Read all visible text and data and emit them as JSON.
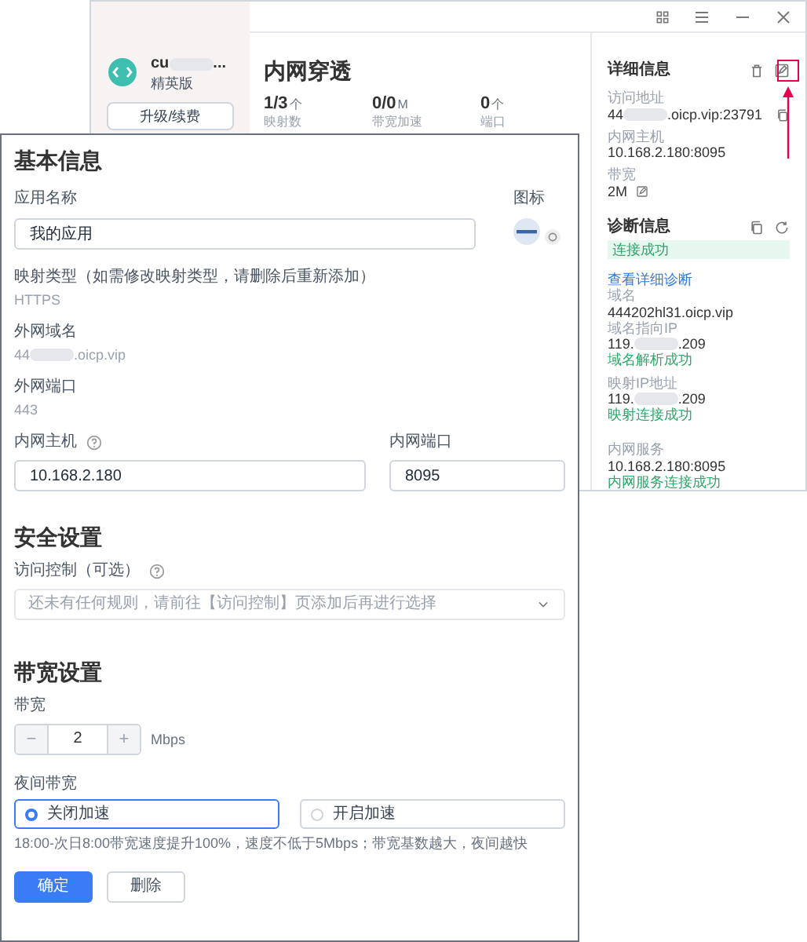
{
  "sidebar": {
    "app_name": {
      "before": "cu",
      "after": "..."
    },
    "edition": "精英版",
    "upgrade_button": "升级/续费"
  },
  "overview": {
    "title": "内网穿透",
    "stats": [
      {
        "value": "1/3",
        "unit": "个",
        "label": "映射数"
      },
      {
        "value": "0/0",
        "unit": "M",
        "label": "带宽加速"
      },
      {
        "value": "0",
        "unit": "个",
        "label": "端口"
      }
    ]
  },
  "details": {
    "title": "详细信息",
    "fields": [
      {
        "label": "访问地址",
        "value": {
          "before": "44",
          "after": ".oicp.vip:23791"
        },
        "kind": "copy"
      },
      {
        "label": "内网主机",
        "value": "10.168.2.180:8095",
        "kind": "plain"
      },
      {
        "label": "带宽",
        "value": "2M",
        "kind": "edit"
      }
    ]
  },
  "diagnosis": {
    "title": "诊断信息",
    "status": "连接成功",
    "link": "查看详细诊断",
    "items": [
      {
        "label": "域名",
        "value": "444202hl31.oicp.vip"
      },
      {
        "label": "域名指向IP",
        "value": {
          "before": "119.",
          "after": ".209"
        },
        "result": "域名解析成功"
      },
      {
        "label": "映射IP地址",
        "value": {
          "before": "119.",
          "after": ".209"
        },
        "result": "映射连接成功"
      },
      {
        "label": "内网服务",
        "value": "10.168.2.180:8095",
        "result": "内网服务连接成功"
      }
    ]
  },
  "dialog": {
    "basic": {
      "title": "基本信息",
      "app_name": {
        "label": "应用名称",
        "value": "我的应用"
      },
      "icon_label": "图标",
      "mapping_type": {
        "label": "映射类型（如需修改映射类型，请删除后重新添加）",
        "value": "HTTPS"
      },
      "domain": {
        "label": "外网域名",
        "value": {
          "before": "44",
          "after": ".oicp.vip"
        }
      },
      "port": {
        "label": "外网端口",
        "value": "443"
      },
      "host": {
        "label": "内网主机",
        "value": "10.168.2.180"
      },
      "inner_port": {
        "label": "内网端口",
        "value": "8095"
      }
    },
    "security": {
      "title": "安全设置",
      "access_control": {
        "label": "访问控制（可选）",
        "placeholder": "还未有任何规则，请前往【访问控制】页添加后再进行选择"
      }
    },
    "bandwidth": {
      "title": "带宽设置",
      "label": "带宽",
      "decrement": "−",
      "value": "2",
      "increment": "+",
      "unit": "Mbps",
      "night": {
        "label": "夜间带宽",
        "options": [
          {
            "label": "关闭加速",
            "selected": true
          },
          {
            "label": "开启加速",
            "selected": false
          }
        ],
        "hint": "18:00-次日8:00带宽速度提升100%，速度不低于5Mbps；带宽基数越大，夜间越快"
      }
    },
    "buttons": [
      {
        "label": "确定",
        "kind": "primary"
      },
      {
        "label": "删除",
        "kind": "default"
      }
    ]
  }
}
